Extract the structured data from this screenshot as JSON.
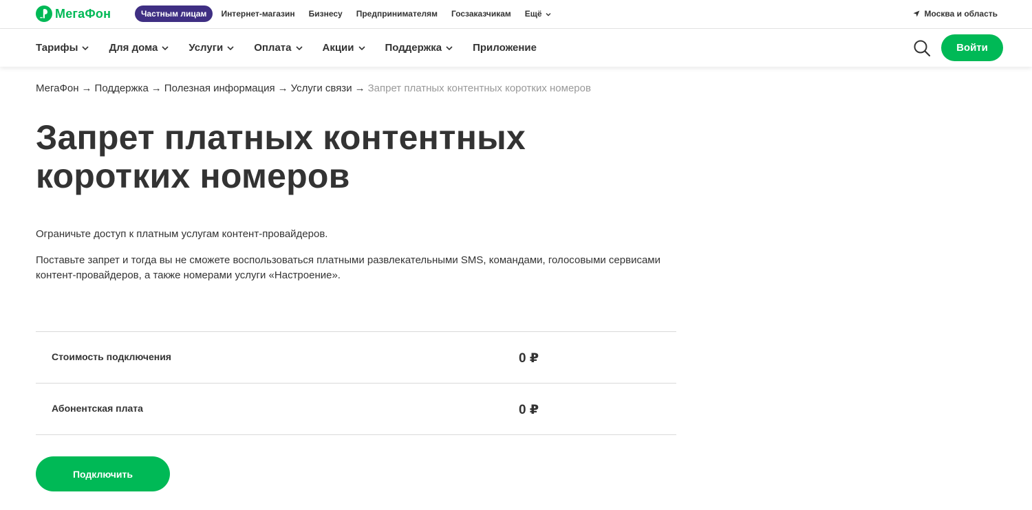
{
  "brand": {
    "logo_text": "МегаФон",
    "accent": "#00b956",
    "segment_active_bg": "#3f2f83"
  },
  "topbar": {
    "segments": [
      {
        "label": "Частным лицам",
        "active": true
      },
      {
        "label": "Интернет-магазин"
      },
      {
        "label": "Бизнесу"
      },
      {
        "label": "Предпринимателям"
      },
      {
        "label": "Госзаказчикам"
      },
      {
        "label": "Ещё"
      }
    ],
    "region": "Москва и область"
  },
  "nav": {
    "items": [
      {
        "label": "Тарифы"
      },
      {
        "label": "Для дома"
      },
      {
        "label": "Услуги"
      },
      {
        "label": "Оплата"
      },
      {
        "label": "Акции"
      },
      {
        "label": "Поддержка"
      },
      {
        "label": "Приложение"
      }
    ],
    "login_label": "Войти"
  },
  "breadcrumb": {
    "items": [
      "МегаФон",
      "Поддержка",
      "Полезная информация",
      "Услуги связи"
    ],
    "separator": "→",
    "current": "Запрет платных контентных коротких номеров"
  },
  "page": {
    "title_line1": "Запрет платных контентных",
    "title_line2": "коротких номеров",
    "intro": "Ограничьте доступ к платным услугам контент-провайдеров.",
    "description": "Поставьте запрет и тогда вы не сможете воспользоваться платными развлекательными SMS, командами, голосовыми сервисами контент-провайдеров, а также номерами услуги «Настроение».",
    "prices": [
      {
        "label": "Стоимость подключения",
        "value": "0 ₽"
      },
      {
        "label": "Абонентская плата",
        "value": "0 ₽"
      }
    ],
    "connect_label": "Подключить"
  }
}
